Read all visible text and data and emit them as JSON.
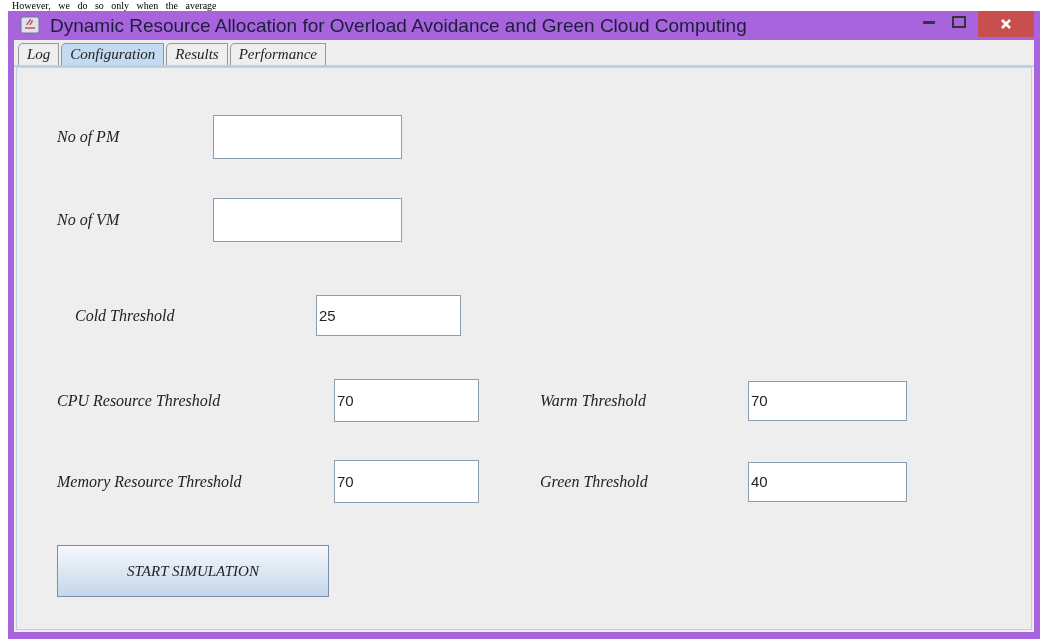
{
  "document_text": "However, we do so only when the average",
  "window": {
    "title": "Dynamic Resource Allocation for Overload Avoidance and Green Cloud Computing"
  },
  "tabs": [
    {
      "label": "Log",
      "selected": false
    },
    {
      "label": "Configuration",
      "selected": true
    },
    {
      "label": "Results",
      "selected": false
    },
    {
      "label": "Performance",
      "selected": false
    }
  ],
  "form": {
    "rows": [
      [
        {
          "label": "No of  PM"
        }
      ],
      [
        {
          "label": "No of  VM"
        }
      ],
      [
        {
          "label": "Cold Threshold",
          "value": "25"
        }
      ],
      [
        {
          "label": "CPU Resource Threshold",
          "value": "70"
        },
        {
          "label": "Warm Threshold",
          "value": "70"
        }
      ],
      [
        {
          "label": "Memory Resource Threshold",
          "value": "70"
        },
        {
          "label": "Green Threshold",
          "value": "40"
        }
      ]
    ],
    "button": "START SIMULATION"
  }
}
